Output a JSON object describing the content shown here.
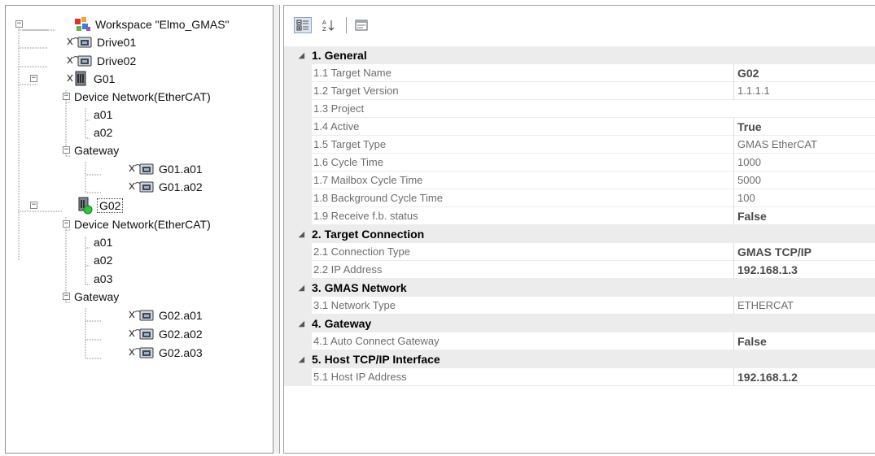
{
  "tree": {
    "root": {
      "label": "Workspace \"Elmo_GMAS\"",
      "icon": "workspace-icon",
      "state": "expanded"
    },
    "nodes": [
      {
        "id": "drive01",
        "label": "Drive01",
        "icon": "drive-icon"
      },
      {
        "id": "drive02",
        "label": "Drive02",
        "icon": "drive-icon"
      },
      {
        "id": "g01",
        "label": "G01",
        "icon": "controller-icon",
        "state": "expanded"
      },
      {
        "id": "g01-devnet",
        "label": "Device Network(EtherCAT)",
        "state": "expanded"
      },
      {
        "id": "g01-a01",
        "label": "a01"
      },
      {
        "id": "g01-a02",
        "label": "a02"
      },
      {
        "id": "g01-gw",
        "label": "Gateway",
        "state": "expanded"
      },
      {
        "id": "g01-gw-a01",
        "label": "G01.a01",
        "icon": "drive-icon"
      },
      {
        "id": "g01-gw-a02",
        "label": "G01.a02",
        "icon": "drive-icon"
      },
      {
        "id": "g02",
        "label": "G02",
        "icon": "controller-online-icon",
        "state": "expanded",
        "selected": true
      },
      {
        "id": "g02-devnet",
        "label": "Device Network(EtherCAT)",
        "state": "expanded"
      },
      {
        "id": "g02-a01",
        "label": "a01"
      },
      {
        "id": "g02-a02",
        "label": "a02"
      },
      {
        "id": "g02-a03",
        "label": "a03"
      },
      {
        "id": "g02-gw",
        "label": "Gateway",
        "state": "expanded"
      },
      {
        "id": "g02-gw-a01",
        "label": "G02.a01",
        "icon": "drive-icon"
      },
      {
        "id": "g02-gw-a02",
        "label": "G02.a02",
        "icon": "drive-icon"
      },
      {
        "id": "g02-gw-a03",
        "label": "G02.a03",
        "icon": "drive-icon"
      }
    ]
  },
  "toolbar": {
    "buttons": [
      {
        "name": "categorized-view-button",
        "icon": "categorized-icon",
        "pressed": true
      },
      {
        "name": "alphabetical-sort-button",
        "icon": "sort-az-icon",
        "pressed": false
      },
      {
        "name": "property-pages-button",
        "icon": "property-pages-icon",
        "pressed": false
      }
    ]
  },
  "properties": [
    {
      "category": "1. General",
      "items": [
        {
          "name": "1.1 Target Name",
          "value": "G02",
          "bold": true
        },
        {
          "name": "1.2 Target Version",
          "value": "1.1.1.1"
        },
        {
          "name": "1.3 Project",
          "value": ""
        },
        {
          "name": "1.4 Active",
          "value": "True",
          "bold": true
        },
        {
          "name": "1.5 Target Type",
          "value": "GMAS EtherCAT"
        },
        {
          "name": "1.6 Cycle Time",
          "value": "1000"
        },
        {
          "name": "1.7 Mailbox Cycle Time",
          "value": "5000"
        },
        {
          "name": "1.8 Background  Cycle Time",
          "value": "100"
        },
        {
          "name": "1.9 Receive f.b. status",
          "value": "False",
          "bold": true
        }
      ]
    },
    {
      "category": "2. Target Connection",
      "items": [
        {
          "name": "2.1 Connection Type",
          "value": "GMAS TCP/IP",
          "bold": true
        },
        {
          "name": "2.2 IP Address",
          "value": "192.168.1.3",
          "bold": true
        }
      ]
    },
    {
      "category": "3. GMAS Network",
      "items": [
        {
          "name": "3.1 Network Type",
          "value": "ETHERCAT"
        }
      ]
    },
    {
      "category": "4. Gateway",
      "items": [
        {
          "name": "4.1 Auto Connect Gateway",
          "value": "False",
          "bold": true
        }
      ]
    },
    {
      "category": "5. Host TCP/IP Interface",
      "items": [
        {
          "name": "5.1 Host IP Address",
          "value": "192.168.1.2",
          "bold": true
        }
      ]
    }
  ]
}
